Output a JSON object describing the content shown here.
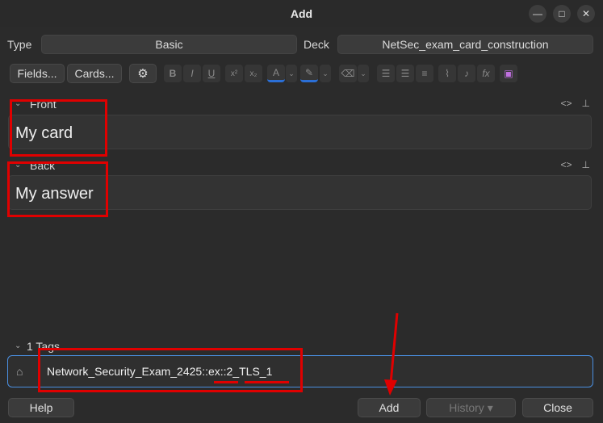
{
  "window": {
    "title": "Add"
  },
  "type_row": {
    "type_label": "Type",
    "type_value": "Basic",
    "deck_label": "Deck",
    "deck_value": "NetSec_exam_card_construction"
  },
  "toolbar": {
    "fields_label": "Fields...",
    "cards_label": "Cards..."
  },
  "fields": [
    {
      "name": "Front",
      "value": "My card"
    },
    {
      "name": "Back",
      "value": "My answer"
    }
  ],
  "tags": {
    "header": "1 Tags",
    "value": "Network_Security_Exam_2425::ex::2_TLS_1"
  },
  "buttons": {
    "help": "Help",
    "add": "Add",
    "history": "History ▾",
    "close": "Close"
  },
  "annotation_color": "#e00000"
}
